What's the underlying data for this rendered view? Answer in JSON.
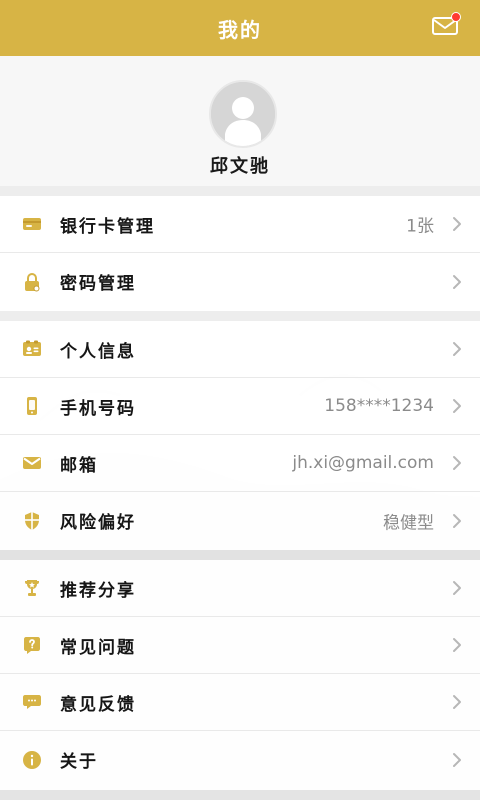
{
  "header": {
    "title": "我的",
    "mail_icon": "mail-icon",
    "has_notification": true
  },
  "profile": {
    "avatar_icon": "user-avatar-icon",
    "name": "邱文驰"
  },
  "menu": {
    "sections": [
      {
        "items": [
          {
            "id": "bank-card",
            "icon": "bank-card-icon",
            "label": "银行卡管理",
            "value": "1张"
          },
          {
            "id": "password",
            "icon": "lock-icon",
            "label": "密码管理",
            "value": ""
          }
        ]
      },
      {
        "items": [
          {
            "id": "personal-info",
            "icon": "id-card-icon",
            "label": "个人信息",
            "value": ""
          },
          {
            "id": "phone",
            "icon": "phone-icon",
            "label": "手机号码",
            "value": "158****1234"
          },
          {
            "id": "email",
            "icon": "mail-icon",
            "label": "邮箱",
            "value": "jh.xi@gmail.com"
          },
          {
            "id": "risk",
            "icon": "shield-icon",
            "label": "风险偏好",
            "value": "稳健型"
          }
        ]
      },
      {
        "items": [
          {
            "id": "recommend",
            "icon": "trophy-icon",
            "label": "推荐分享",
            "value": ""
          },
          {
            "id": "faq",
            "icon": "question-icon",
            "label": "常见问题",
            "value": ""
          },
          {
            "id": "feedback",
            "icon": "chat-icon",
            "label": "意见反馈",
            "value": ""
          },
          {
            "id": "about",
            "icon": "info-icon",
            "label": "关于",
            "value": ""
          }
        ]
      }
    ]
  },
  "colors": {
    "accent": "#d7b445",
    "accent_dark": "#c9a53a",
    "notification_dot": "#ff3b30",
    "value_text": "#8b8b8b"
  }
}
